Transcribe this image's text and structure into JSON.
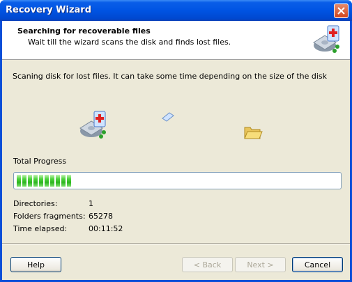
{
  "window": {
    "title": "Recovery Wizard"
  },
  "header": {
    "title": "Searching for recoverable files",
    "subtitle": "Wait till the wizard scans the disk and finds lost files."
  },
  "description": "Scaning disk for lost files. It can take some time depending on the size of the disk",
  "progress": {
    "label": "Total Progress",
    "fraction": 0.18
  },
  "stats": [
    {
      "label": "Directories:",
      "value": "1"
    },
    {
      "label": "Folders fragments:",
      "value": "65278"
    },
    {
      "label": "Time elapsed:",
      "value": "00:11:52"
    }
  ],
  "buttons": {
    "help": "Help",
    "back": "< Back",
    "next": "Next >",
    "cancel": "Cancel"
  },
  "icons": {
    "close": "close-icon",
    "header": "disk-recovery-icon",
    "source": "disk-recovery-icon",
    "transfer": "flying-document-icon",
    "target": "folder-icon"
  }
}
